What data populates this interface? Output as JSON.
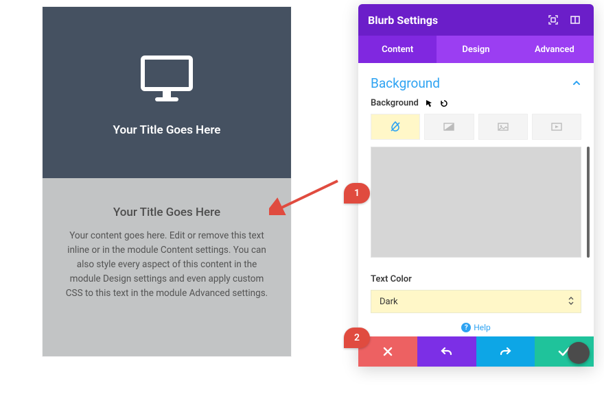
{
  "preview": {
    "top_title": "Your Title Goes Here",
    "bottom_title": "Your Title Goes Here",
    "bottom_text": "Your content goes here. Edit or remove this text inline or in the module Content settings. You can also style every aspect of this content in the module Design settings and even apply custom CSS to this text in the module Advanced settings."
  },
  "panel": {
    "title": "Blurb Settings",
    "tabs": [
      "Content",
      "Design",
      "Advanced"
    ],
    "active_tab_index": 0,
    "section_title": "Background",
    "background_label": "Background",
    "text_color_label": "Text Color",
    "text_color_value": "Dark",
    "help_label": "Help"
  },
  "callouts": {
    "one": "1",
    "two": "2"
  }
}
